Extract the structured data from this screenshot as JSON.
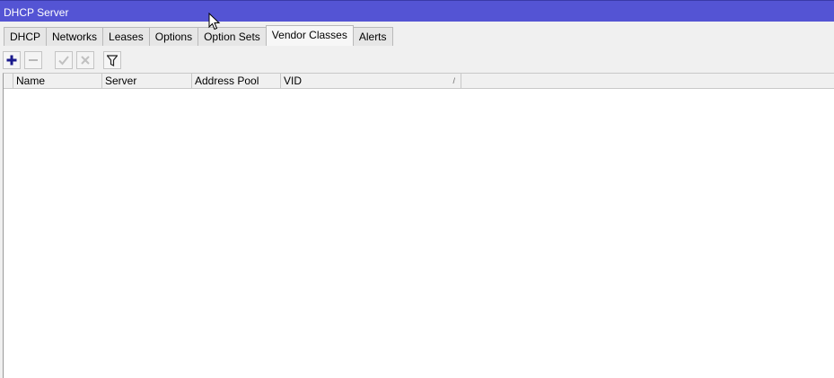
{
  "window": {
    "title": "DHCP Server"
  },
  "tabs": [
    {
      "label": "DHCP"
    },
    {
      "label": "Networks"
    },
    {
      "label": "Leases"
    },
    {
      "label": "Options"
    },
    {
      "label": "Option Sets"
    },
    {
      "label": "Vendor Classes",
      "active": true
    },
    {
      "label": "Alerts"
    }
  ],
  "toolbar": {
    "buttons": [
      "add-icon",
      "remove-icon",
      "enable-icon",
      "disable-icon",
      "filter-icon"
    ]
  },
  "table": {
    "columns": [
      "Name",
      "Server",
      "Address Pool",
      "VID"
    ],
    "rows": []
  },
  "colors": {
    "titlebar": "#5454d4",
    "add_icon": "#1a1a8c"
  }
}
